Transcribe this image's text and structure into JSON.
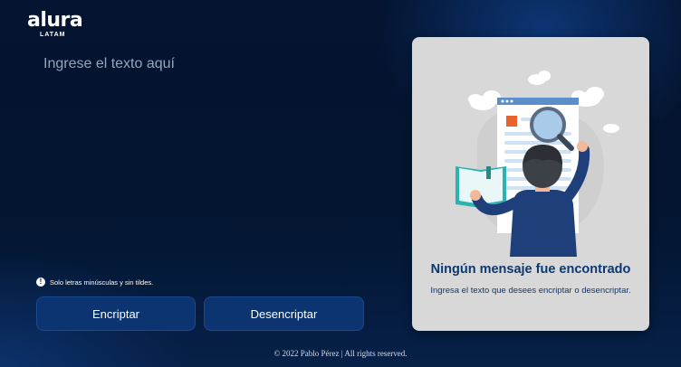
{
  "logo": {
    "main": "alura",
    "sub": "LATAM"
  },
  "input": {
    "placeholder": "Ingrese el texto aquí"
  },
  "hint": {
    "icon": "exclamation-circle-icon",
    "text": "Solo letras minúsculas y sin tildes."
  },
  "buttons": {
    "encrypt": "Encriptar",
    "decrypt": "Desencriptar"
  },
  "result_card": {
    "illustration": "person-with-magnifier-illustration",
    "title": "Ningún mensaje fue encontrado",
    "subtitle": "Ingresa el texto que desees encriptar o desencriptar."
  },
  "footer": {
    "text": "© 2022 Pablo Pérez | All rights reserved."
  },
  "colors": {
    "accent": "#0a3871",
    "button_bg": "#0c3470",
    "card_bg": "#d8d8d8",
    "page_bg": "#041431"
  }
}
